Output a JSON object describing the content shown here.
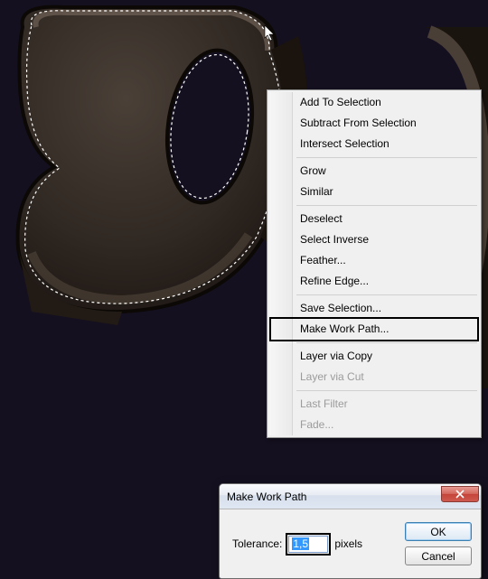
{
  "context_menu": {
    "group1": {
      "add": "Add To Selection",
      "subtract": "Subtract From Selection",
      "intersect": "Intersect Selection"
    },
    "group2": {
      "grow": "Grow",
      "similar": "Similar"
    },
    "group3": {
      "deselect": "Deselect",
      "inverse": "Select Inverse",
      "feather": "Feather...",
      "refine": "Refine Edge..."
    },
    "group4": {
      "save_sel": "Save Selection...",
      "make_path": "Make Work Path..."
    },
    "group5": {
      "layer_copy": "Layer via Copy",
      "layer_cut": "Layer via Cut"
    },
    "group6": {
      "last_filter": "Last Filter",
      "fade": "Fade..."
    }
  },
  "dialog": {
    "title": "Make Work Path",
    "tolerance_label": "Tolerance:",
    "tolerance_value": "1,5",
    "unit": "pixels",
    "ok": "OK",
    "cancel": "Cancel"
  }
}
